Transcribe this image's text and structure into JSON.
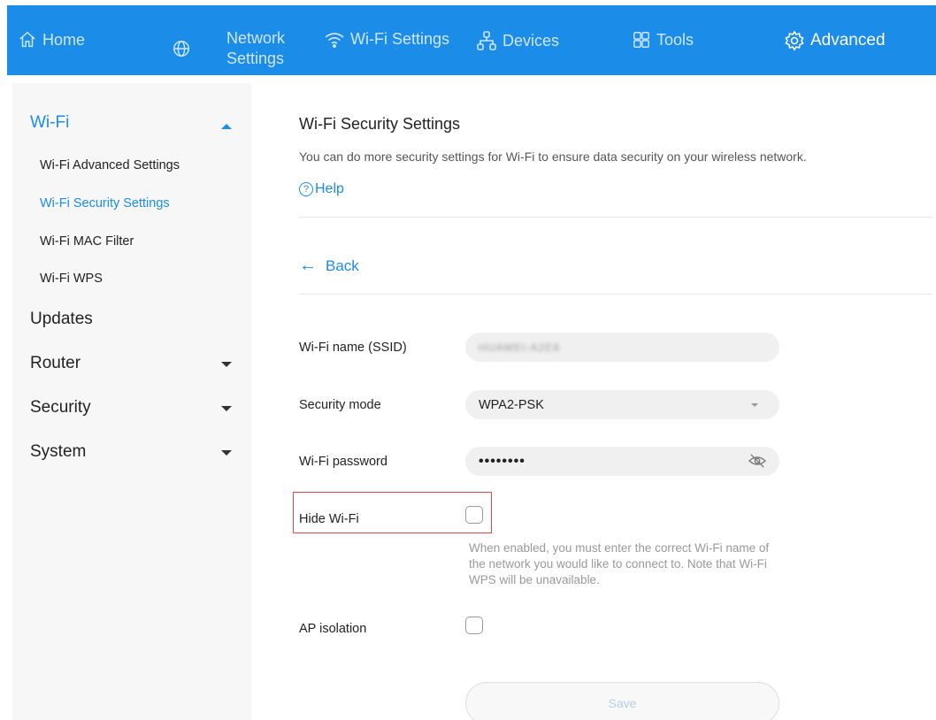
{
  "nav": {
    "home": "Home",
    "network_line1": "Network",
    "network_line2": "Settings",
    "wifi_settings": "Wi-Fi Settings",
    "devices": "Devices",
    "tools": "Tools",
    "advanced": "Advanced"
  },
  "sidebar": {
    "wifi": {
      "label": "Wi-Fi",
      "items": [
        "Wi-Fi Advanced Settings",
        "Wi-Fi Security Settings",
        "Wi-Fi MAC Filter",
        "Wi-Fi WPS"
      ]
    },
    "updates": "Updates",
    "router": "Router",
    "security": "Security",
    "system": "System"
  },
  "page": {
    "title": "Wi-Fi Security Settings",
    "description": "You can do more security settings for Wi-Fi to ensure data security on your wireless network.",
    "help": "Help",
    "back": "Back"
  },
  "form": {
    "ssid_label": "Wi-Fi name (SSID)",
    "ssid_value": "HUAWEI-A2E8",
    "security_mode_label": "Security mode",
    "security_mode_value": "WPA2-PSK",
    "password_label": "Wi-Fi password",
    "password_value": "••••••••",
    "hide_wifi_label": "Hide Wi-Fi",
    "hide_wifi_hint": "When enabled, you must enter the correct Wi-Fi name of the network you would like to connect to. Note that Wi-Fi WPS will be unavailable.",
    "ap_isolation_label": "AP isolation",
    "save": "Save"
  },
  "colors": {
    "accent": "#1b8ce8",
    "highlight": "#e04848"
  }
}
